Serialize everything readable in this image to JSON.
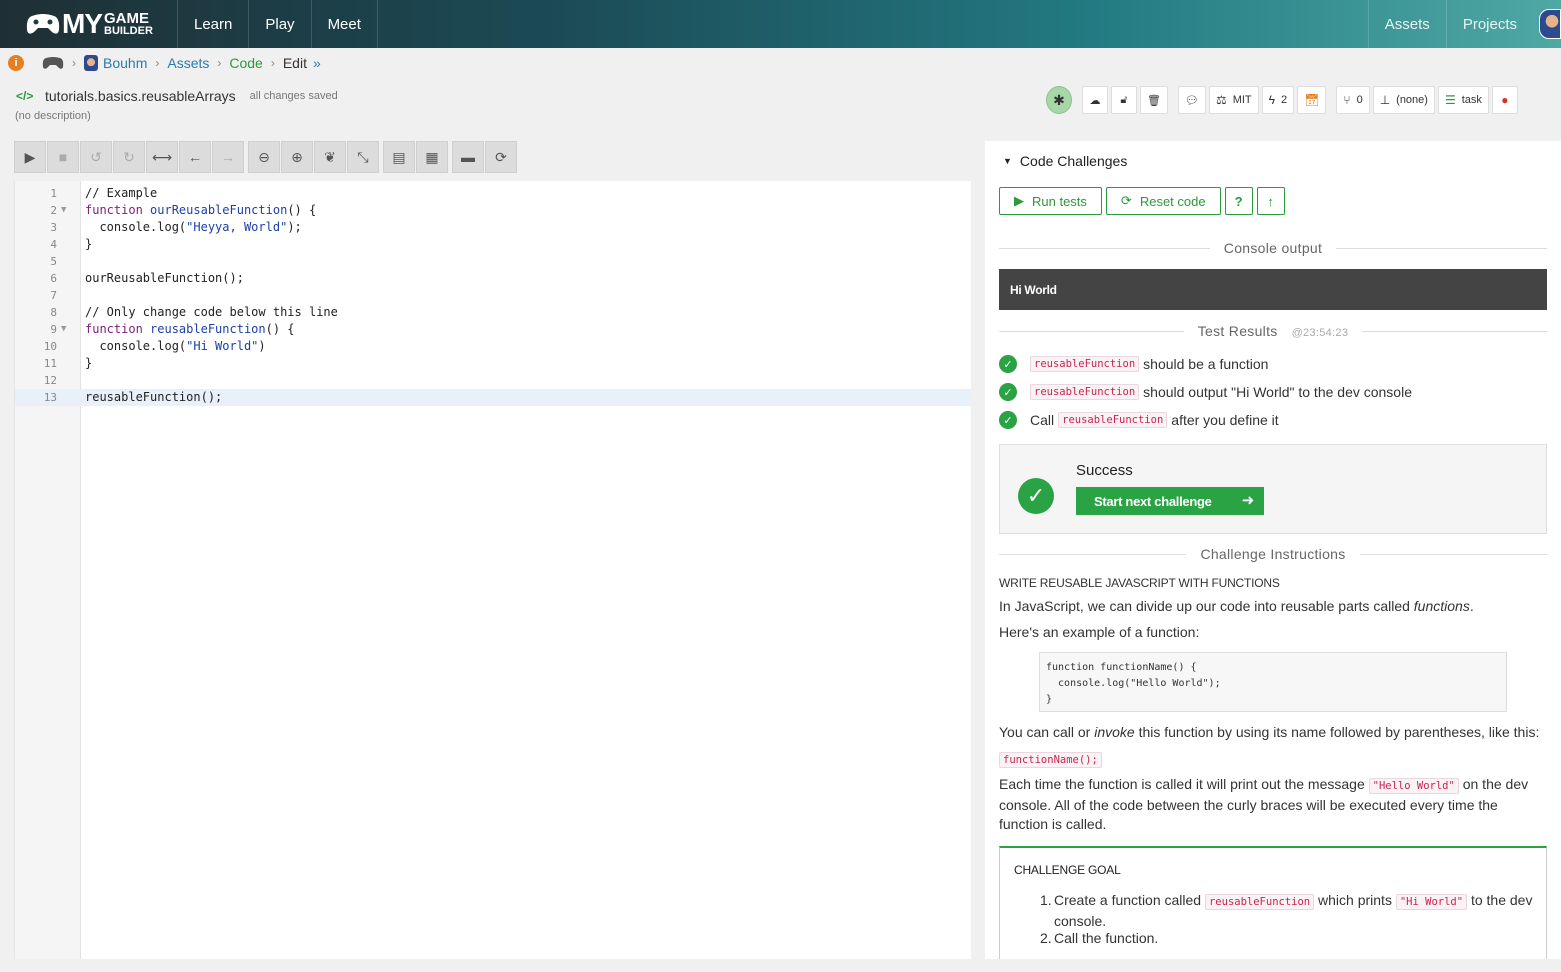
{
  "nav": {
    "logo_my": "MY",
    "logo_game": "GAME",
    "logo_builder": "BUILDER",
    "left_links": [
      "Learn",
      "Play",
      "Meet"
    ],
    "right_links": [
      "Assets",
      "Projects"
    ]
  },
  "breadcrumb": {
    "user": "Bouhm",
    "assets": "Assets",
    "code": "Code",
    "edit": "Edit"
  },
  "file": {
    "name": "tutorials.basics.reusableArrays",
    "status": "all changes saved",
    "description": "(no description)"
  },
  "toolbar": {
    "license": "MIT",
    "lightning_count": "2",
    "fork_count": "0",
    "parent": "(none)",
    "kind": "task"
  },
  "code": {
    "lines": [
      "// Example",
      "function ourReusableFunction() {",
      "  console.log(\"Heyya, World\");",
      "}",
      "",
      "ourReusableFunction();",
      "",
      "// Only change code below this line",
      "function reusableFunction() {",
      "  console.log(\"Hi World\")",
      "}",
      "",
      "reusableFunction();"
    ]
  },
  "challenges": {
    "header": "Code Challenges",
    "run_tests": "Run tests",
    "reset_code": "Reset code",
    "help": "?",
    "console_label": "Console output",
    "console_text": "Hi World",
    "results_label": "Test Results",
    "results_time": "@23:54:23",
    "tests": [
      {
        "before": "",
        "code": "reusableFunction",
        "after": "should be a function"
      },
      {
        "before": "",
        "code": "reusableFunction",
        "after": "should output \"Hi World\" to the dev console"
      },
      {
        "before": "Call",
        "code": "reusableFunction",
        "after": "after you define it"
      }
    ],
    "success_title": "Success",
    "next_button": "Start next challenge",
    "instructions_label": "Challenge Instructions",
    "instr_title": "WRITE REUSABLE JAVASCRIPT WITH FUNCTIONS",
    "instr_p1_a": "In JavaScript, we can divide up our code into reusable parts called ",
    "instr_p1_em": "functions",
    "instr_p1_b": ".",
    "instr_p2": "Here's an example of a function:",
    "example_code": "function functionName() {\n  console.log(\"Hello World\");\n}",
    "instr_p3_a": "You can call or ",
    "instr_p3_em": "invoke",
    "instr_p3_b": " this function by using its name followed by parentheses, like this:",
    "call_code": "functionName();",
    "instr_p4_a": "Each time the function is called it will print out the message ",
    "instr_p4_code": "\"Hello World\"",
    "instr_p4_b": " on the dev console. All of the code between the curly braces will be executed every time the function is called.",
    "goal_title": "CHALLENGE GOAL",
    "goal_1_a": "Create a function called ",
    "goal_1_code": "reusableFunction",
    "goal_1_b": " which prints ",
    "goal_1_code2": "\"Hi World\"",
    "goal_1_c": " to the dev console.",
    "goal_2": "Call the function."
  },
  "colors": {
    "accent_green": "#2aa345",
    "link_blue": "#2a7ab0",
    "console_bg": "#444444"
  }
}
